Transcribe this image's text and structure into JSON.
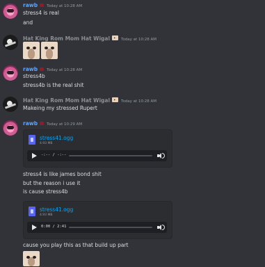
{
  "messages": [
    {
      "author": "rawb",
      "timestamp": "Today at 10:28 AM",
      "lines": [
        "stress4 is real",
        "and"
      ]
    },
    {
      "author": "Hat King Rom Mom Hat Wigal",
      "timestamp": "Today at 10:28 AM",
      "images": 2
    },
    {
      "author": "rawb",
      "timestamp": "Today at 10:28 AM",
      "lines": [
        "stress4b",
        "stress4b is the real shit"
      ]
    },
    {
      "author": "Hat King Rom Mom Hat Wigal",
      "timestamp": "Today at 10:28 AM",
      "lines": [
        "Makeing my stressed Rupert"
      ]
    },
    {
      "author": "rawb",
      "timestamp": "Today at 10:29 AM",
      "attachments": [
        {
          "filename": "stress41.ogg",
          "size": "4.93 MB",
          "time": "-:-- / -:--",
          "progress": 0
        }
      ],
      "lines": [
        "stress4 is like james bond shit",
        "but the reason i use it",
        "is cause stress4b"
      ],
      "attachments2": [
        {
          "filename": "stress41.ogg",
          "size": "4.93 MB",
          "time": "0:00 / 2:41",
          "progress": 0
        }
      ],
      "lines2": [
        "cause you play this as that build up part"
      ]
    }
  ],
  "colors": {
    "background": "#313338",
    "author_rawb": "#5ea5ff",
    "author_other": "#8b8e92",
    "link": "#00a8fc",
    "timestamp": "#949ba4"
  }
}
